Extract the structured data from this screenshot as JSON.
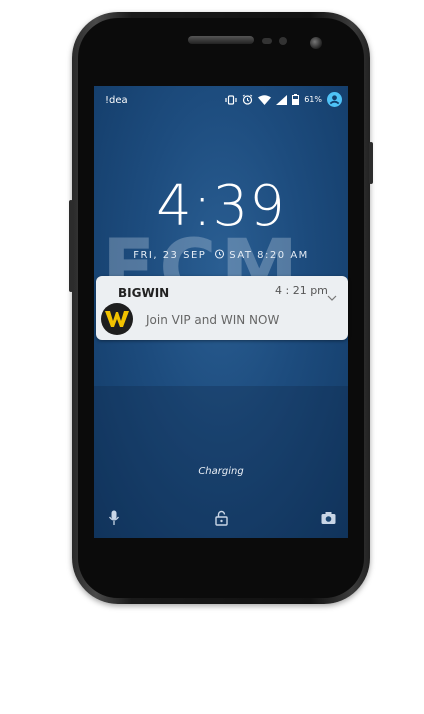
{
  "status_bar": {
    "carrier": "!dea",
    "battery_percent": "61%",
    "icons": [
      "vibrate-icon",
      "alarm-icon",
      "wifi-icon",
      "signal-icon",
      "battery-icon",
      "user-icon"
    ]
  },
  "wallpaper": {
    "watermark_text": "FCM"
  },
  "lockscreen": {
    "time": "4:39",
    "date": "FRI, 23 SEP",
    "alarm": "SAT 8:20 AM",
    "charging_text": "Charging"
  },
  "notification": {
    "app_name": "BIGWIN",
    "time": "4 : 21 pm",
    "message": "Join VIP and WIN NOW",
    "icon": "bigwin-logo-icon",
    "accent_color": "#f2c200"
  },
  "bottom_actions": [
    "mic-icon",
    "lock-icon",
    "camera-icon"
  ]
}
